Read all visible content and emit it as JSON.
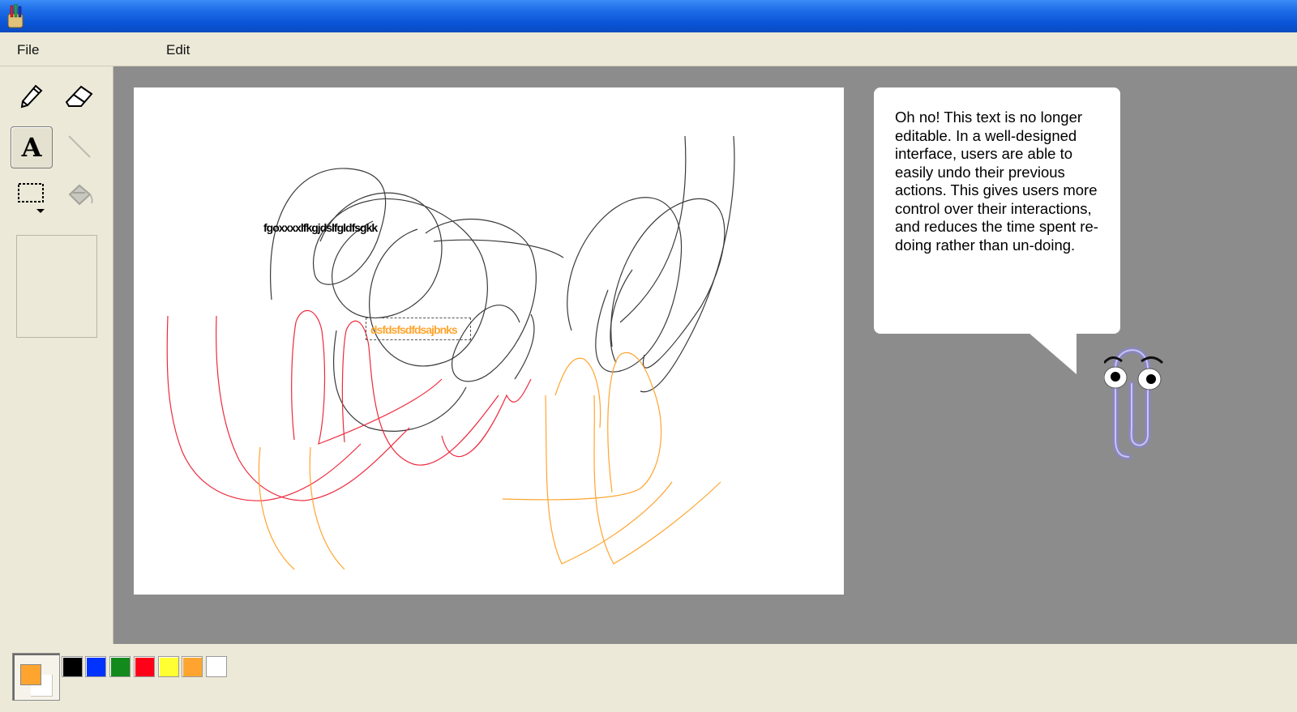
{
  "menu": {
    "file": "File",
    "edit": "Edit"
  },
  "tools": [
    {
      "name": "pencil-tool",
      "icon": "pencil-icon",
      "selected": false
    },
    {
      "name": "eraser-tool",
      "icon": "eraser-icon",
      "selected": false
    },
    {
      "name": "text-tool",
      "icon": "text-a-icon",
      "glyph": "A",
      "selected": true
    },
    {
      "name": "line-tool",
      "icon": "line-icon",
      "selected": false
    },
    {
      "name": "select-tool",
      "icon": "dashed-rect-icon",
      "selected": false
    },
    {
      "name": "fill-tool",
      "icon": "paint-bucket-icon",
      "selected": false
    }
  ],
  "canvas": {
    "black_text": "fgoxxxxlfkgjdslfgldfsgkk",
    "orange_text": "dsfdsfsdfdsajbnks"
  },
  "assistant": {
    "message": "Oh no! This text is no longer editable. In a well-designed interface, users are able to easily undo their previous actions. This gives users more control over their interactions, and reduces the time spent re-doing rather than un-doing.",
    "character": "paperclip-assistant-icon"
  },
  "palette": {
    "foreground": "#ffa52f",
    "background": "#ffffff",
    "colors": [
      "#000000",
      "#0033ff",
      "#138a1c",
      "#ff0019",
      "#ffff33",
      "#ffa52f",
      "#ffffff"
    ]
  }
}
